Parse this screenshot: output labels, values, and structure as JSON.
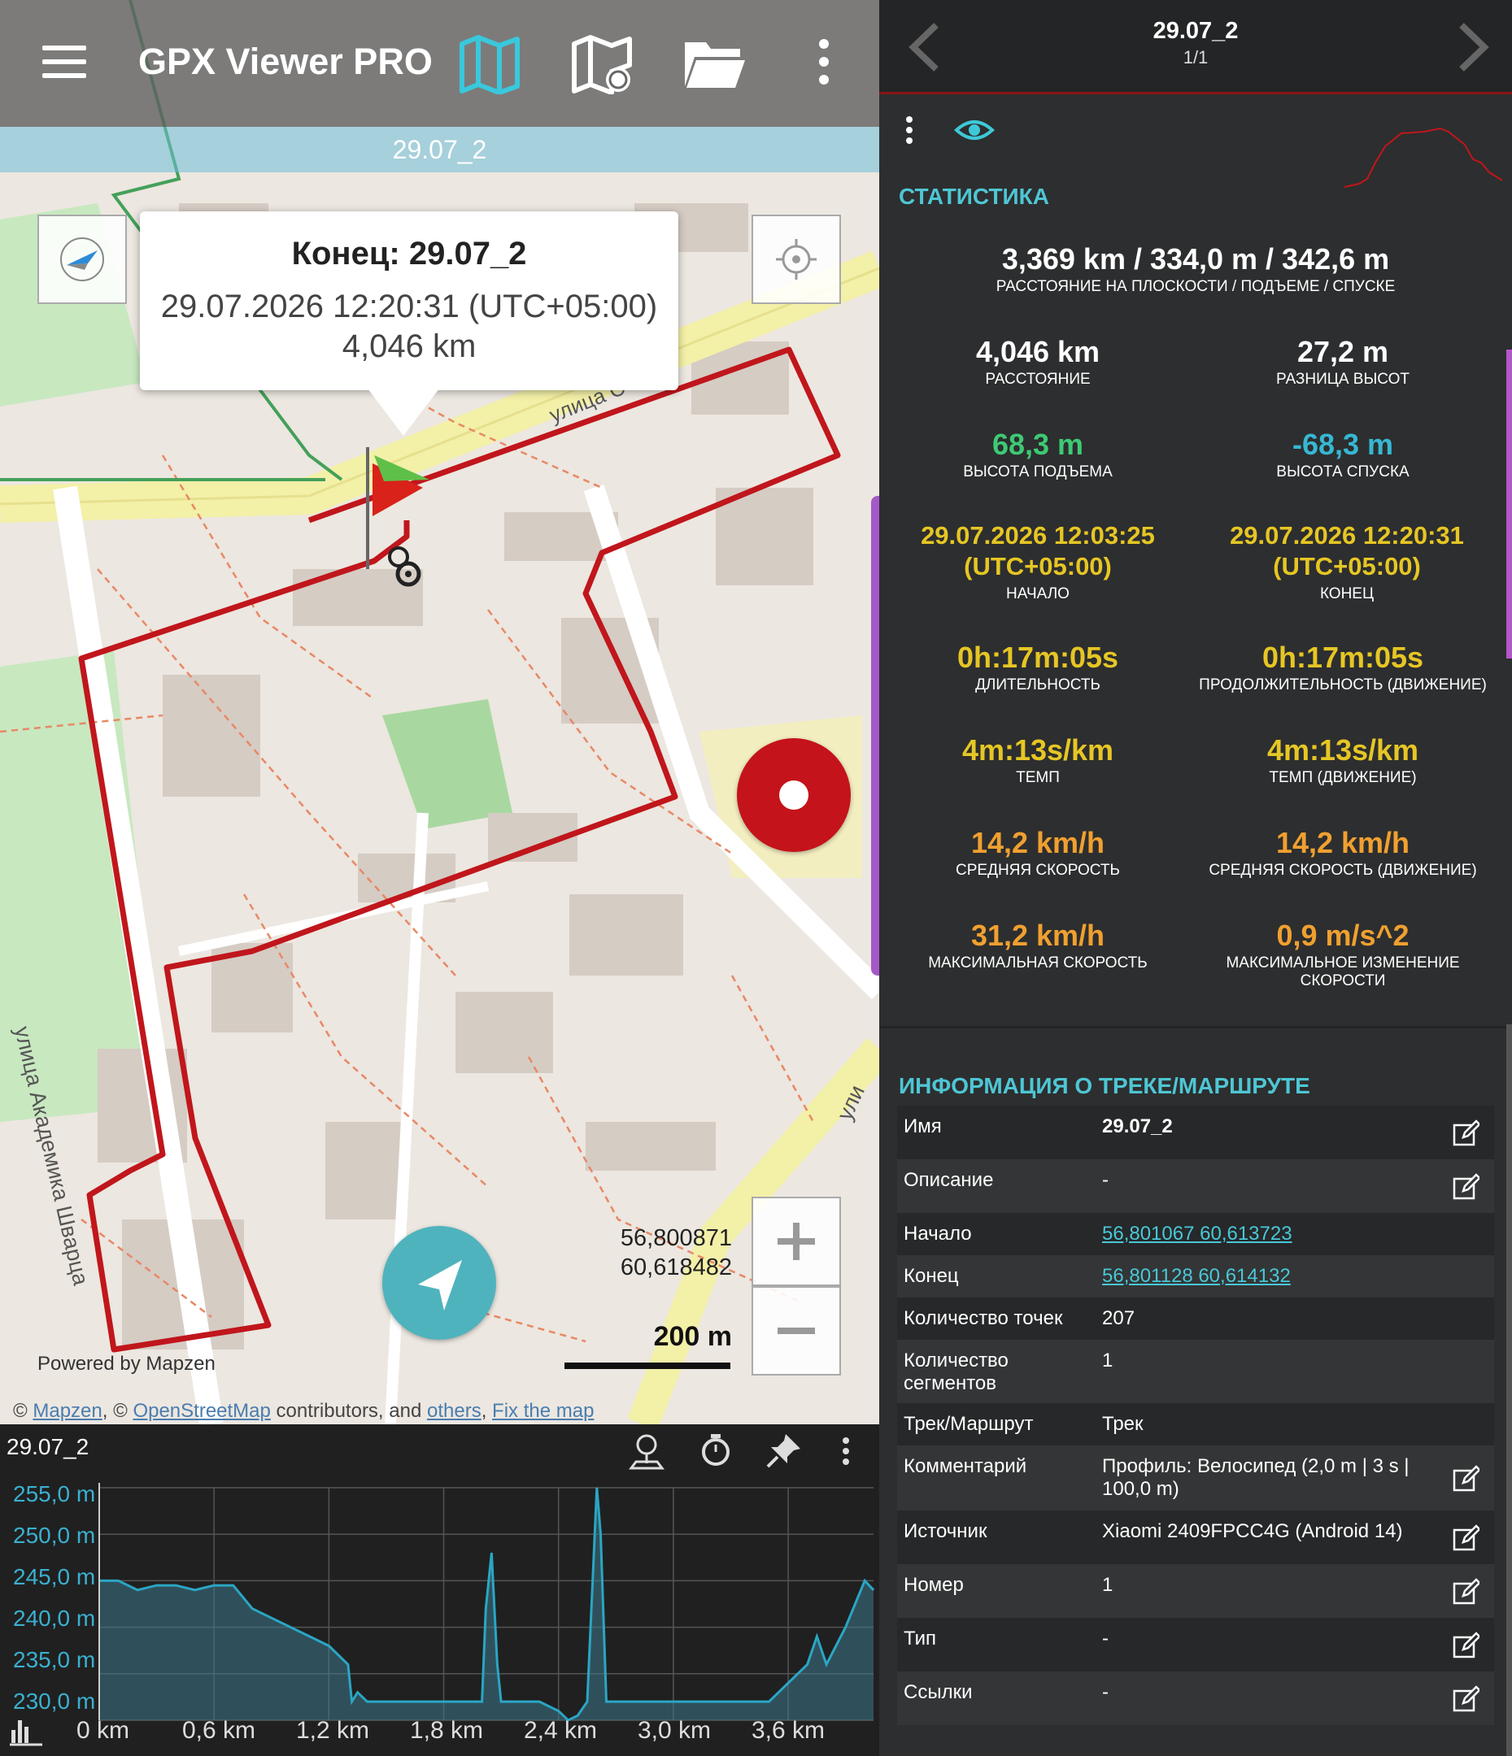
{
  "app": {
    "title": "GPX Viewer PRO"
  },
  "toolbar": {
    "icons": [
      "menu-icon",
      "map-layers-icon",
      "offline-map-icon",
      "folder-icon",
      "more-vert-icon"
    ]
  },
  "map": {
    "track_banner": "29.07_2",
    "popup": {
      "title": "Конец: 29.07_2",
      "time": "29.07.2026 12:20:31 (UTC+05:00)",
      "distance": "4,046 km"
    },
    "coords": {
      "lat": "56,800871",
      "lon": "60,618482"
    },
    "scale": "200 m",
    "powered_by": "Powered by Mapzen",
    "attribution": {
      "prefix": "© ",
      "mapzen": "Mapzen",
      "sep": ", © ",
      "osm": "OpenStreetMap",
      "contrib": " contributors, and ",
      "others": "others",
      "sep2": ", ",
      "fix": "Fix the map"
    },
    "street_labels": [
      "улица С",
      "улица Академика Шварца",
      "ули"
    ],
    "route_color": "#c0161c"
  },
  "elevation": {
    "title": "29.07_2",
    "y_labels": [
      "255,0 m",
      "250,0 m",
      "245,0 m",
      "240,0 m",
      "235,0 m",
      "230,0 m"
    ],
    "x_labels": [
      "0 km",
      "0,6 km",
      "1,2 km",
      "1,8 km",
      "2,4 km",
      "3,0 km",
      "3,6 km"
    ],
    "line_color": "#2aa6c4"
  },
  "chart_data": {
    "type": "area",
    "title": "",
    "xlabel": "",
    "ylabel": "",
    "xlim": [
      0,
      4.046
    ],
    "ylim": [
      230,
      255
    ],
    "x": [
      0,
      0.1,
      0.2,
      0.3,
      0.4,
      0.5,
      0.6,
      0.7,
      0.8,
      0.9,
      1.0,
      1.1,
      1.2,
      1.3,
      1.32,
      1.35,
      1.4,
      1.5,
      1.6,
      1.7,
      1.8,
      1.9,
      2.0,
      2.02,
      2.05,
      2.08,
      2.1,
      2.2,
      2.3,
      2.4,
      2.45,
      2.5,
      2.55,
      2.6,
      2.62,
      2.65,
      2.7,
      2.8,
      2.9,
      3.0,
      3.1,
      3.2,
      3.3,
      3.4,
      3.5,
      3.6,
      3.7,
      3.75,
      3.8,
      3.9,
      4.0,
      4.046
    ],
    "values": [
      245,
      245,
      244,
      244.5,
      244.5,
      244,
      244.5,
      244.5,
      242,
      241,
      240,
      239,
      238,
      236,
      232,
      233,
      232,
      232,
      232,
      232,
      232,
      232,
      232,
      242,
      248,
      236,
      232,
      232,
      232,
      231,
      230,
      230.5,
      232,
      255,
      250,
      232,
      232,
      232,
      232,
      232,
      232,
      232,
      232,
      232,
      232,
      234,
      236,
      239,
      236,
      240,
      245,
      244
    ]
  },
  "stats": {
    "section_title": "СТАТИСТИКА",
    "summary": {
      "value": "3,369 km / 334,0 m / 342,6 m",
      "label": "РАССТОЯНИЕ НА ПЛОСКОСТИ / ПОДЪЕМЕ / СПУСКЕ"
    },
    "items": [
      {
        "value": "4,046 km",
        "label": "РАССТОЯНИЕ"
      },
      {
        "value": "27,2 m",
        "label": "РАЗНИЦА ВЫСОТ"
      },
      {
        "value": "68,3 m",
        "label": "ВЫСОТА ПОДЪЕМА"
      },
      {
        "value": "-68,3 m",
        "label": "ВЫСОТА СПУСКА"
      },
      {
        "value": "29.07.2026 12:03:25 (UTC+05:00)",
        "label": "НАЧАЛО"
      },
      {
        "value": "29.07.2026 12:20:31 (UTC+05:00)",
        "label": "КОНЕЦ"
      },
      {
        "value": "0h:17m:05s",
        "label": "ДЛИТЕЛЬНОСТЬ"
      },
      {
        "value": "0h:17m:05s",
        "label": "ПРОДОЛЖИТЕЛЬНОСТЬ (ДВИЖЕНИЕ)"
      },
      {
        "value": "4m:13s/km",
        "label": "ТЕМП"
      },
      {
        "value": "4m:13s/km",
        "label": "ТЕМП (ДВИЖЕНИЕ)"
      },
      {
        "value": "14,2 km/h",
        "label": "СРЕДНЯЯ СКОРОСТЬ"
      },
      {
        "value": "14,2 km/h",
        "label": "СРЕДНЯЯ СКОРОСТЬ (ДВИЖЕНИЕ)"
      },
      {
        "value": "31,2 km/h",
        "label": "МАКСИМАЛЬНАЯ СКОРОСТЬ"
      },
      {
        "value": "0,9 m/s^2",
        "label": "МАКСИМАЛЬНОЕ ИЗМЕНЕНИЕ СКОРОСТИ"
      }
    ]
  },
  "header": {
    "title": "29.07_2",
    "page": "1/1"
  },
  "info": {
    "section_title": "ИНФОРМАЦИЯ О ТРЕКЕ/МАРШРУТЕ",
    "rows": [
      {
        "key": "Имя",
        "value": "29.07_2"
      },
      {
        "key": "Описание",
        "value": "-"
      },
      {
        "key": "Начало",
        "value": "56,801067 60,613723"
      },
      {
        "key": "Конец",
        "value": "56,801128 60,614132"
      },
      {
        "key": "Количество точек",
        "value": "207"
      },
      {
        "key": "Количество сегментов",
        "value": "1"
      },
      {
        "key": "Трек/Маршрут",
        "value": "Трек"
      },
      {
        "key": "Комментарий",
        "value": "Профиль: Велосипед (2,0 m | 3 s | 100,0 m)"
      },
      {
        "key": "Источник",
        "value": "Xiaomi 2409FPCC4G (Android 14)"
      },
      {
        "key": "Номер",
        "value": "1"
      },
      {
        "key": "Тип",
        "value": "-"
      },
      {
        "key": "Ссылки",
        "value": "-"
      }
    ]
  }
}
